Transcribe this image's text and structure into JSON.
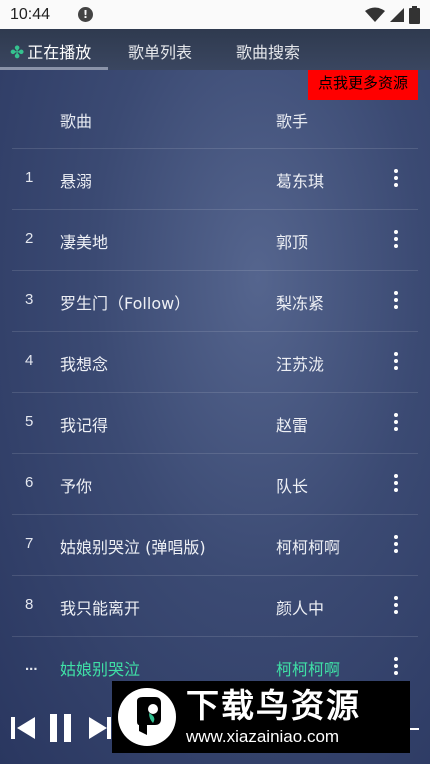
{
  "status_bar": {
    "time": "10:44",
    "alert_icon": "alert-icon",
    "wifi_icon": "wifi-icon",
    "signal_icon": "signal-icon",
    "battery_icon": "battery-icon"
  },
  "tabs": [
    {
      "label": "正在播放",
      "icon": "clover-icon",
      "active": true
    },
    {
      "label": "歌单列表",
      "active": false
    },
    {
      "label": "歌曲搜索",
      "active": false
    }
  ],
  "promo_label": "点我更多资源",
  "table": {
    "headers": {
      "song": "歌曲",
      "artist": "歌手"
    },
    "rows": [
      {
        "num": "1",
        "title": "悬溺",
        "artist": "葛东琪"
      },
      {
        "num": "2",
        "title": "凄美地",
        "artist": "郭顶"
      },
      {
        "num": "3",
        "title": "罗生门（Follow）",
        "artist": "梨冻紧"
      },
      {
        "num": "4",
        "title": "我想念",
        "artist": "汪苏泷"
      },
      {
        "num": "5",
        "title": "我记得",
        "artist": "赵雷"
      },
      {
        "num": "6",
        "title": "予你",
        "artist": "队长"
      },
      {
        "num": "7",
        "title": "姑娘别哭泣 (弹唱版)",
        "artist": "柯柯柯啊"
      },
      {
        "num": "8",
        "title": "我只能离开",
        "artist": "颜人中"
      },
      {
        "num": "...",
        "title": "姑娘别哭泣",
        "artist": "柯柯柯啊",
        "playing": true
      }
    ]
  },
  "player": {
    "prev_icon": "skip-previous-icon",
    "pause_icon": "pause-icon",
    "next_icon": "skip-next-icon"
  },
  "watermark": {
    "title": "下载鸟资源",
    "url": "www.xiazainiao.com"
  },
  "colors": {
    "accent": "#3fe0a6",
    "promo_bg": "#ff0000",
    "tab_bg": "#36425a"
  }
}
